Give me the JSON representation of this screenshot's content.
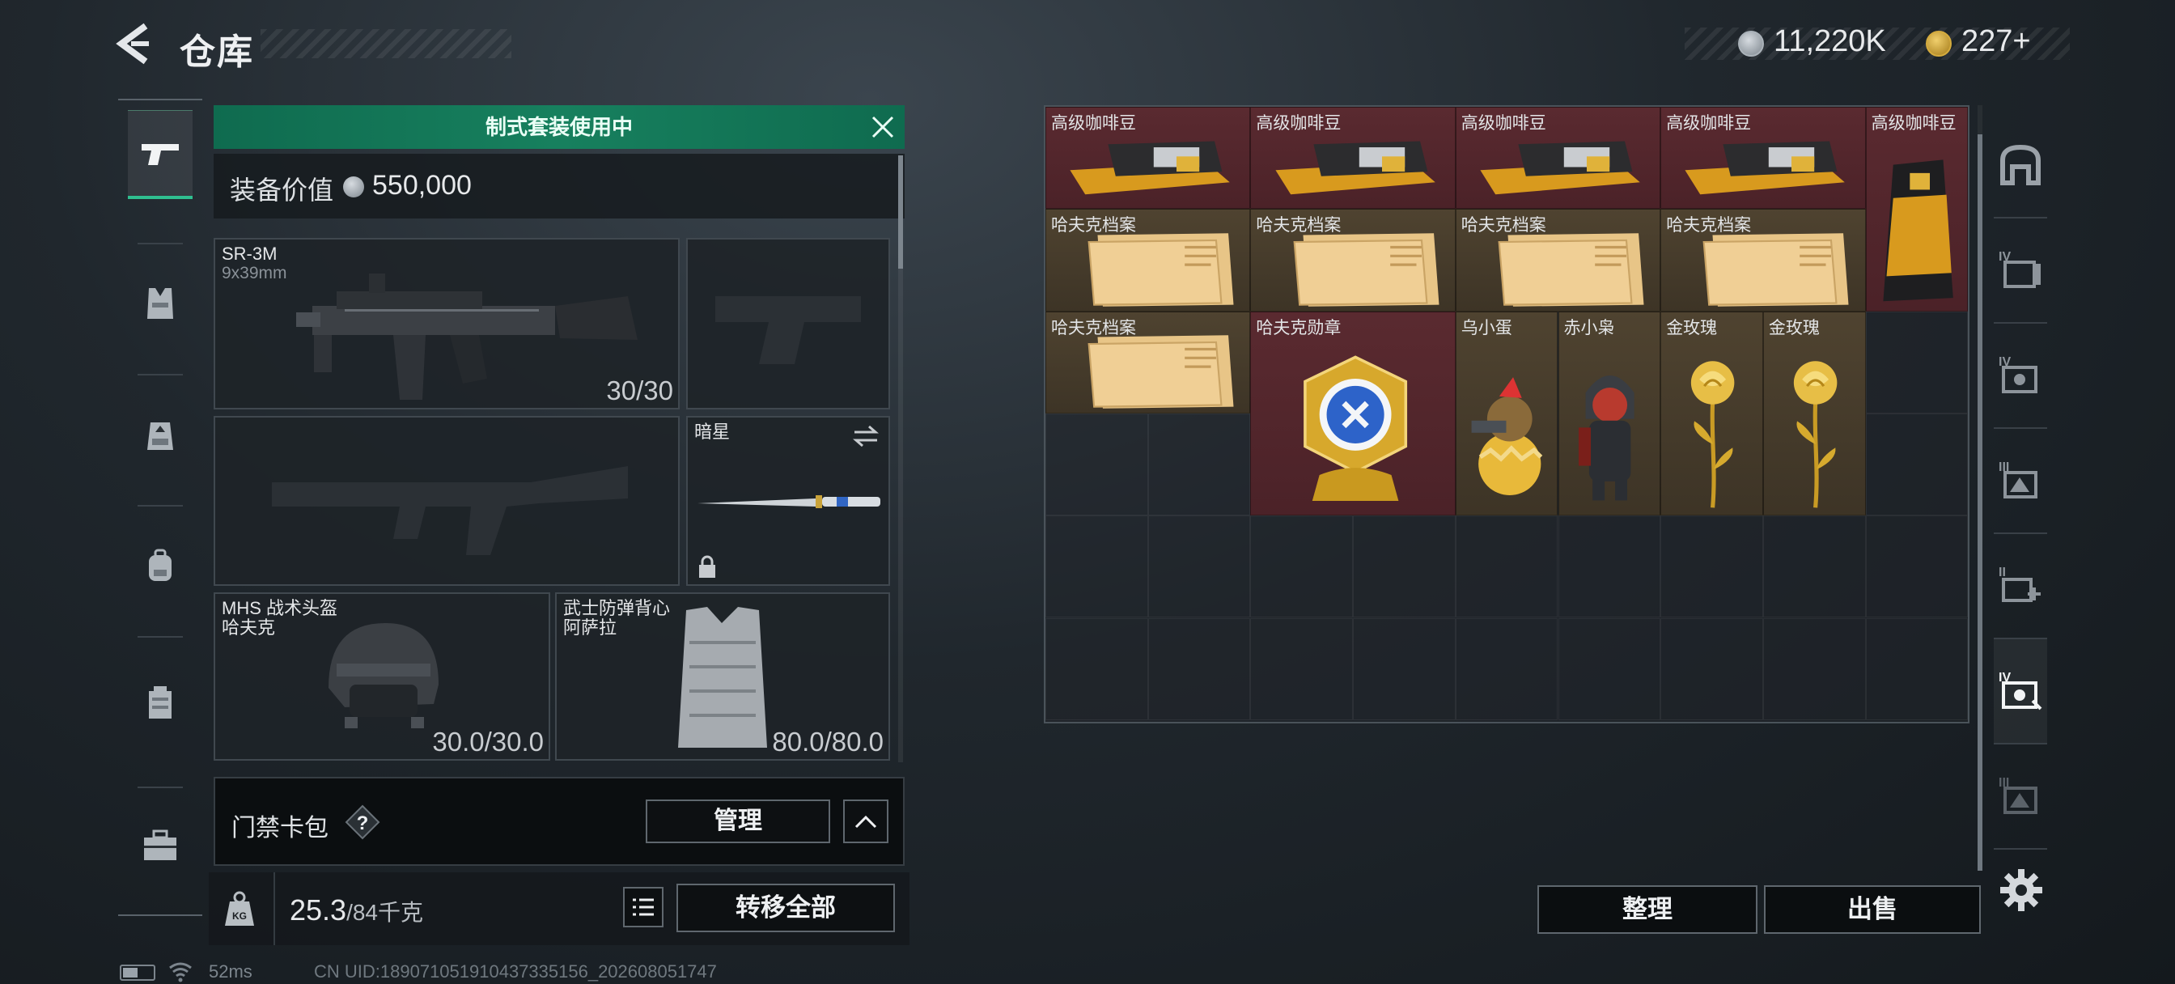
{
  "header": {
    "title": "仓库",
    "currency_silver": "11,220K",
    "currency_gold": "227+"
  },
  "left_rail": {
    "items": [
      {
        "name": "weapons",
        "icon": "pistol-icon",
        "active": true
      },
      {
        "name": "armor",
        "icon": "vest-icon"
      },
      {
        "name": "rig",
        "icon": "chest-rig-icon"
      },
      {
        "name": "backpack",
        "icon": "backpack-icon"
      },
      {
        "name": "storage-box",
        "icon": "container-icon"
      },
      {
        "name": "case",
        "icon": "briefcase-icon"
      }
    ]
  },
  "loadout": {
    "banner": "制式套装使用中",
    "value_label": "装备价值",
    "value": "550,000",
    "primary_weapon": {
      "name": "SR-3M",
      "ammo": "9x39mm",
      "count": "30/30"
    },
    "melee": {
      "name": "暗星"
    },
    "helmet": {
      "name": "MHS 战术头盔",
      "brand": "哈夫克",
      "durability": "30.0/30.0"
    },
    "armor": {
      "name": "武士防弹背心",
      "brand": "阿萨拉",
      "durability": "80.0/80.0"
    },
    "keycard_label": "门禁卡包",
    "keycard_help": "?",
    "manage_label": "管理",
    "weight_value": "25.3",
    "weight_max": "/84千克",
    "transfer_all_label": "转移全部"
  },
  "storage": {
    "items": [
      {
        "label": "高级咖啡豆",
        "rarity": "red",
        "icon": "coffee-beans-icon"
      },
      {
        "label": "高级咖啡豆",
        "rarity": "red",
        "icon": "coffee-beans-icon"
      },
      {
        "label": "高级咖啡豆",
        "rarity": "red",
        "icon": "coffee-beans-icon"
      },
      {
        "label": "高级咖啡豆",
        "rarity": "red",
        "icon": "coffee-beans-icon"
      },
      {
        "label": "高级咖啡豆",
        "rarity": "red",
        "icon": "coffee-bag-icon"
      },
      {
        "label": "哈夫克档案",
        "rarity": "gold",
        "icon": "dossier-icon"
      },
      {
        "label": "哈夫克档案",
        "rarity": "gold",
        "icon": "dossier-icon"
      },
      {
        "label": "哈夫克档案",
        "rarity": "gold",
        "icon": "dossier-icon"
      },
      {
        "label": "哈夫克档案",
        "rarity": "gold",
        "icon": "dossier-icon"
      },
      {
        "label": "哈夫克档案",
        "rarity": "gold",
        "icon": "dossier-icon"
      },
      {
        "label": "哈夫克勋章",
        "rarity": "red",
        "icon": "medal-icon"
      },
      {
        "label": "乌小蛋",
        "rarity": "gold",
        "icon": "egg-figure-icon"
      },
      {
        "label": "赤小枭",
        "rarity": "gold",
        "icon": "hooded-figure-icon"
      },
      {
        "label": "金玫瑰",
        "rarity": "gold",
        "icon": "gold-rose-icon"
      },
      {
        "label": "金玫瑰",
        "rarity": "gold",
        "icon": "gold-rose-icon"
      }
    ],
    "sort_label": "整理",
    "sell_label": "出售"
  },
  "right_tabs": [
    "IV",
    "IV",
    "III",
    "II",
    "IV",
    "III"
  ],
  "status": {
    "ping": "52ms",
    "uid": "CN UID:189071051910437335156_202608051747"
  },
  "colors": {
    "accent_green": "#17805e",
    "rarity_red": "#5a2a30",
    "rarity_gold": "#4f4330"
  }
}
